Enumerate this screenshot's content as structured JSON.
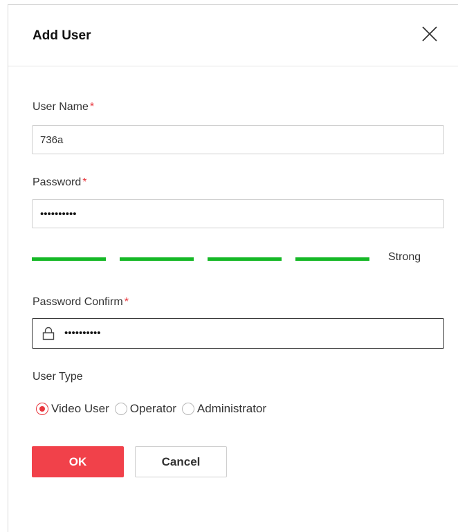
{
  "dialog": {
    "title": "Add User"
  },
  "form": {
    "user_name": {
      "label": "User Name",
      "required_mark": "*",
      "value": "736a"
    },
    "password": {
      "label": "Password",
      "required_mark": "*",
      "value": "••••••••••"
    },
    "strength": {
      "text": "Strong",
      "segments_filled": 4,
      "segments_total": 4,
      "color": "#15b826"
    },
    "password_confirm": {
      "label": "Password Confirm",
      "required_mark": "*",
      "value": "••••••••••",
      "icon": "lock-icon"
    },
    "user_type": {
      "label": "User Type",
      "options": [
        "Video User",
        "Operator",
        "Administrator"
      ],
      "selected": "Video User"
    }
  },
  "buttons": {
    "ok_label": "OK",
    "cancel_label": "Cancel"
  },
  "colors": {
    "accent": "#f1414a",
    "required": "#e8373e",
    "strength": "#15b826"
  }
}
